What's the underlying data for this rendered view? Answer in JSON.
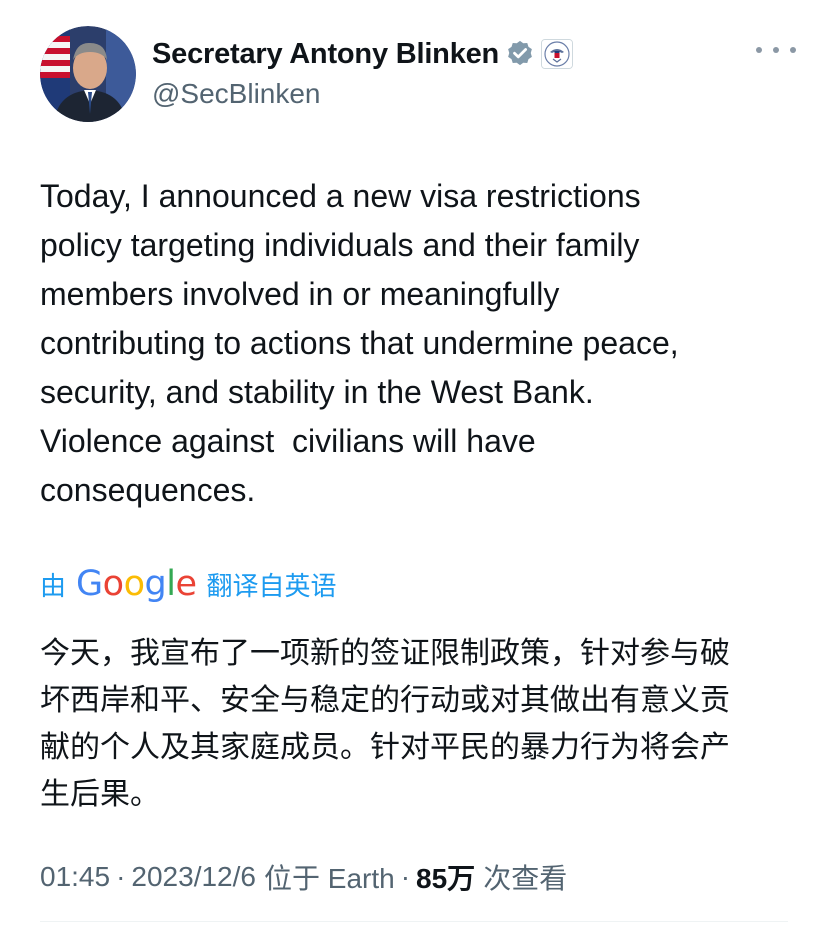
{
  "author": {
    "display_name": "Secretary Antony Blinken",
    "handle": "@SecBlinken",
    "verified_badge_color": "#829aab"
  },
  "tweet": {
    "text_lines": [
      "Today, I announced a new visa restrictions",
      "policy targeting individuals and their family",
      "members involved in or meaningfully",
      "contributing to actions that undermine peace,",
      "security, and stability in the West Bank.",
      "Violence against  civilians will have",
      "consequences."
    ]
  },
  "translation": {
    "prefix": "由",
    "provider": "Google",
    "suffix": "翻译自英语",
    "link_color": "#1d9bf0",
    "text_lines": [
      "今天，我宣布了一项新的签证限制政策，针对参与破",
      "坏西岸和平、安全与稳定的行动或对其做出有意义贡",
      "献的个人及其家庭成员。针对平民的暴力行为将会产",
      "生后果。"
    ]
  },
  "meta": {
    "time": "01:45",
    "date": "2023/12/6",
    "location": "位于 Earth",
    "views_count": "85万",
    "views_label": "次查看"
  },
  "icons": {
    "more": "more-horizontal-icon",
    "verified": "verified-badge-icon",
    "affiliate": "state-department-seal-icon"
  }
}
